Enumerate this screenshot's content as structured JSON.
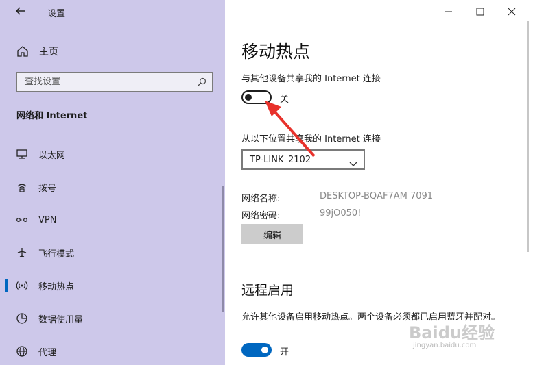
{
  "window": {
    "title": "设置"
  },
  "sidebar": {
    "home_label": "主页",
    "search_placeholder": "查找设置",
    "section": "网络和 Internet",
    "items": [
      {
        "label": "以太网",
        "icon": "ethernet-icon"
      },
      {
        "label": "拨号",
        "icon": "dialup-icon"
      },
      {
        "label": "VPN",
        "icon": "vpn-icon"
      },
      {
        "label": "飞行模式",
        "icon": "airplane-icon"
      },
      {
        "label": "移动热点",
        "icon": "hotspot-icon",
        "selected": true
      },
      {
        "label": "数据使用量",
        "icon": "data-usage-icon"
      },
      {
        "label": "代理",
        "icon": "globe-icon"
      }
    ]
  },
  "main": {
    "title": "移动热点",
    "share_label": "与其他设备共享我的 Internet 连接",
    "share_toggle": {
      "state": "off",
      "text": "关"
    },
    "share_from_label": "从以下位置共享我的 Internet 连接",
    "share_from_value": "TP-LINK_2102",
    "network_name_key": "网络名称:",
    "network_name_value": "DESKTOP-BQAF7AM 7091",
    "network_password_key": "网络密码:",
    "network_password_value": "99jO050!",
    "edit_button": "编辑",
    "remote_title": "远程启用",
    "remote_desc": "允许其他设备启用移动热点。两个设备必须都已启用蓝牙并配对。",
    "remote_toggle": {
      "state": "on",
      "text": "开"
    }
  },
  "watermark": {
    "logo": "Baidu经验",
    "sub": "jingyan.baidu.com"
  },
  "colors": {
    "sidebar_bg": "#cdc8ea",
    "accent": "#0067c0",
    "annotation_arrow": "#e8322c"
  }
}
